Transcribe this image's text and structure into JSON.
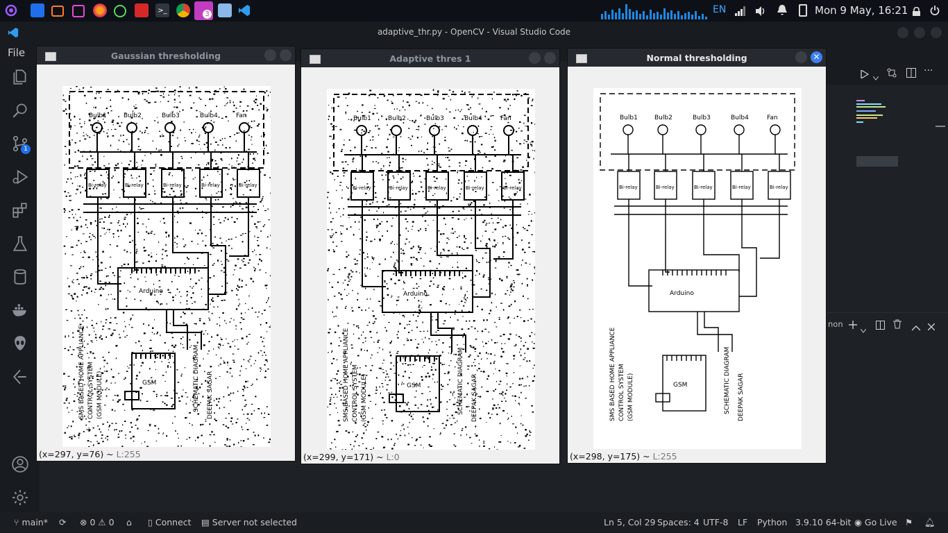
{
  "system_bar": {
    "language": "EN",
    "datetime": "Mon 9 May, 16:21",
    "taskbar_badge": "3"
  },
  "vscode": {
    "window_title": "adaptive_thr.py - OpenCV - Visual Studio Code",
    "menu_file": "File",
    "scm_badge": "1",
    "panel_label": "non"
  },
  "windows": [
    {
      "title": "Gaussian thresholding",
      "coords": "(x=297, y=76) ~ ",
      "level": "L:255",
      "variant": "noisy"
    },
    {
      "title": "Adaptive thres 1",
      "coords": "(x=299, y=171) ~ ",
      "level": "L:0",
      "variant": "noisy"
    },
    {
      "title": "Normal thresholding",
      "coords": "(x=298, y=175) ~ ",
      "level": "L:255",
      "variant": "clean"
    }
  ],
  "sketch_labels": {
    "bulbs": [
      "Bulb1",
      "Bulb2",
      "Bulb3",
      "Bulb4",
      "Fan"
    ],
    "relays": [
      "Bi-relay",
      "Bi-relay",
      "Bi-relay",
      "Bi-relay",
      "Bi-relay"
    ],
    "arduino": "Arduino",
    "gsm": "GSM",
    "title_lines": [
      "SMS BASED HOME APPLIANCE",
      "CONTROL SYSTEM",
      "(GSM MODULE)"
    ],
    "diagram": "SCHEMATIC DIAGRAM",
    "author": "DEEPAK SAGAR"
  },
  "status_bar": {
    "branch": "main*",
    "errors": "0",
    "warnings": "0",
    "connect": "Connect",
    "server": "Server not selected",
    "position": "Ln 5, Col 29",
    "spaces": "Spaces: 4",
    "encoding": "UTF-8",
    "eol": "LF",
    "language": "Python",
    "interpreter": "3.9.10 64-bit",
    "golive": "Go Live"
  }
}
